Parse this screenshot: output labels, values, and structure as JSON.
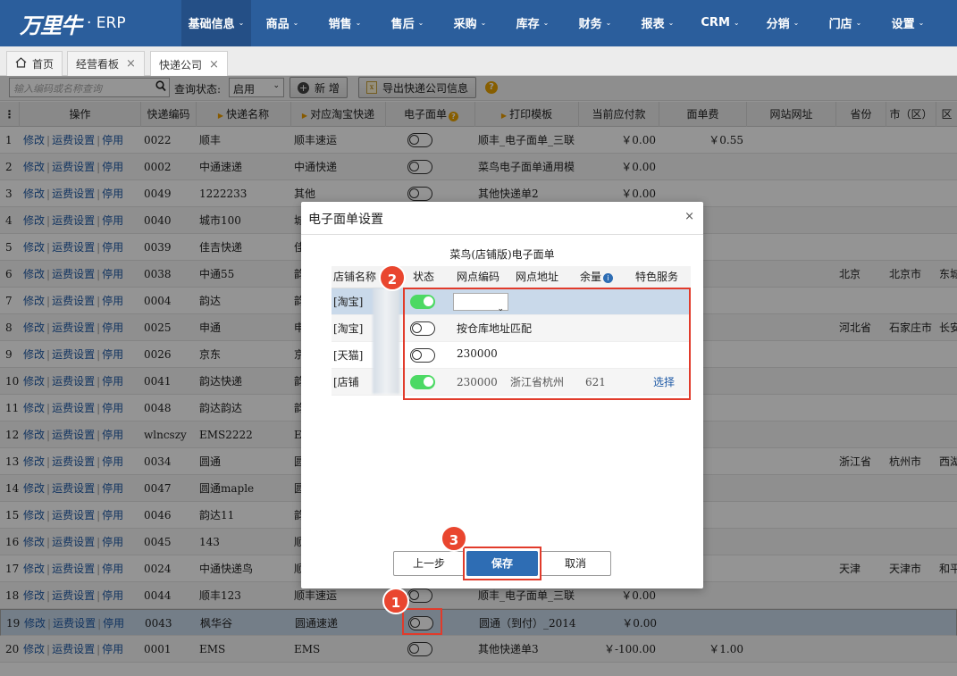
{
  "app": {
    "logo_mark": "万里牛",
    "logo_suffix": "· ERP"
  },
  "nav": [
    {
      "label": "基础信息",
      "w": 78
    },
    {
      "label": "商品",
      "w": 70
    },
    {
      "label": "销售",
      "w": 70
    },
    {
      "label": "售后",
      "w": 70
    },
    {
      "label": "采购",
      "w": 70
    },
    {
      "label": "库存",
      "w": 70
    },
    {
      "label": "财务",
      "w": 70
    },
    {
      "label": "报表",
      "w": 70
    },
    {
      "label": "CRM",
      "w": 70
    },
    {
      "label": "分销",
      "w": 70
    },
    {
      "label": "门店",
      "w": 70
    },
    {
      "label": "设置",
      "w": 70
    }
  ],
  "tabs": [
    {
      "label": "首页"
    },
    {
      "label": "经营看板"
    },
    {
      "label": "快递公司"
    }
  ],
  "toolbar": {
    "search_placeholder": "输入编码或名称查询",
    "query_label": "查询状态:",
    "status_value": "启用",
    "add_label": "新 增",
    "export_label": "导出快递公司信息"
  },
  "columns": [
    "操作",
    "快递编码",
    "快递名称",
    "对应淘宝快递",
    "电子面单",
    "打印模板",
    "当前应付款",
    "面单费",
    "网站网址",
    "省份",
    "市（区）",
    "区"
  ],
  "ops": {
    "edit": "修改",
    "ship": "运费设置",
    "stop": "停用"
  },
  "rows": [
    {
      "n": "1",
      "code": "0022",
      "name": "顺丰",
      "tb": "顺丰速运",
      "tpl": "顺丰_电子面单_三联",
      "pay": "￥0.00",
      "fee": "￥0.55",
      "prov": "",
      "city": "",
      "dist": ""
    },
    {
      "n": "2",
      "code": "0002",
      "name": "中通速递",
      "tb": "中通快递",
      "tpl": "菜鸟电子面单通用模板",
      "pay": "￥0.00",
      "fee": "",
      "prov": "",
      "city": "",
      "dist": ""
    },
    {
      "n": "3",
      "code": "0049",
      "name": "1222233",
      "tb": "其他",
      "tpl": "其他快递单2",
      "pay": "￥0.00",
      "fee": "",
      "prov": "",
      "city": "",
      "dist": ""
    },
    {
      "n": "4",
      "code": "0040",
      "name": "城市100",
      "tb": "城",
      "tpl": "",
      "pay": "",
      "fee": "",
      "prov": "",
      "city": "",
      "dist": ""
    },
    {
      "n": "5",
      "code": "0039",
      "name": "佳吉快递",
      "tb": "佳",
      "tpl": "",
      "pay": "",
      "fee": "",
      "prov": "",
      "city": "",
      "dist": ""
    },
    {
      "n": "6",
      "code": "0038",
      "name": "中通55",
      "tb": "韵",
      "tpl": "",
      "pay": "",
      "fee": "",
      "prov": "北京",
      "city": "北京市",
      "dist": "东城"
    },
    {
      "n": "7",
      "code": "0004",
      "name": "韵达",
      "tb": "韵",
      "tpl": "",
      "pay": "",
      "fee": "",
      "prov": "",
      "city": "",
      "dist": ""
    },
    {
      "n": "8",
      "code": "0025",
      "name": "申通",
      "tb": "申",
      "tpl": "",
      "pay": "",
      "fee": "",
      "prov": "河北省",
      "city": "石家庄市",
      "dist": "长安"
    },
    {
      "n": "9",
      "code": "0026",
      "name": "京东",
      "tb": "京",
      "tpl": "",
      "pay": "",
      "fee": "",
      "prov": "",
      "city": "",
      "dist": ""
    },
    {
      "n": "10",
      "code": "0041",
      "name": "韵达快递",
      "tb": "韵",
      "tpl": "",
      "pay": "",
      "fee": "",
      "prov": "",
      "city": "",
      "dist": ""
    },
    {
      "n": "11",
      "code": "0048",
      "name": "韵达韵达",
      "tb": "韵",
      "tpl": "",
      "pay": "",
      "fee": "",
      "prov": "",
      "city": "",
      "dist": ""
    },
    {
      "n": "12",
      "code": "wlncszy",
      "name": "EMS2222",
      "tb": "E",
      "tpl": "",
      "pay": "",
      "fee": "",
      "prov": "",
      "city": "",
      "dist": ""
    },
    {
      "n": "13",
      "code": "0034",
      "name": "圆通",
      "tb": "圆",
      "tpl": "",
      "pay": "",
      "fee": "",
      "prov": "浙江省",
      "city": "杭州市",
      "dist": "西湖"
    },
    {
      "n": "14",
      "code": "0047",
      "name": "圆通maple",
      "tb": "圆",
      "tpl": "",
      "pay": "",
      "fee": "",
      "prov": "",
      "city": "",
      "dist": ""
    },
    {
      "n": "15",
      "code": "0046",
      "name": "韵达11",
      "tb": "韵",
      "tpl": "",
      "pay": "",
      "fee": "",
      "prov": "",
      "city": "",
      "dist": ""
    },
    {
      "n": "16",
      "code": "0045",
      "name": "143",
      "tb": "顺",
      "tpl": "",
      "pay": "",
      "fee": "",
      "prov": "",
      "city": "",
      "dist": ""
    },
    {
      "n": "17",
      "code": "0024",
      "name": "中通快递鸟",
      "tb": "顺",
      "tpl": "",
      "pay": "",
      "fee": "",
      "prov": "天津",
      "city": "天津市",
      "dist": "和平"
    },
    {
      "n": "18",
      "code": "0044",
      "name": "顺丰123",
      "tb": "顺丰速运",
      "tpl": "顺丰_电子面单_三联",
      "pay": "￥0.00",
      "fee": "",
      "prov": "",
      "city": "",
      "dist": ""
    },
    {
      "n": "19",
      "code": "0043",
      "name": "枫华谷",
      "tb": "圆通速递",
      "tpl": "圆通（到付）_2014",
      "pay": "￥0.00",
      "fee": "",
      "prov": "",
      "city": "",
      "dist": ""
    },
    {
      "n": "20",
      "code": "0001",
      "name": "EMS",
      "tb": "EMS",
      "tpl": "其他快递单3",
      "pay": "￥-100.00",
      "fee": "￥1.00",
      "prov": "",
      "city": "",
      "dist": ""
    }
  ],
  "modal": {
    "title": "电子面单设置",
    "subtitle": "菜鸟(店铺版)电子面单",
    "columns": [
      "店铺名称",
      "状态",
      "网点编码",
      "网点地址",
      "余量",
      "特色服务"
    ],
    "rows": [
      {
        "shop": "[淘宝]",
        "code": "",
        "addr": "",
        "qty": "",
        "svc": ""
      },
      {
        "shop": "[淘宝]",
        "code": "按仓库地址匹配",
        "addr": "",
        "qty": "",
        "svc": ""
      },
      {
        "shop": "[天猫]",
        "code": "230000",
        "addr": "",
        "qty": "",
        "svc": ""
      },
      {
        "shop": "[店铺",
        "code": "230000",
        "addr": "浙江省杭州",
        "qty": "621",
        "svc": "选择"
      }
    ],
    "prev_label": "上一步",
    "save_label": "保存",
    "cancel_label": "取消"
  },
  "annotations": [
    "1",
    "2",
    "3"
  ]
}
